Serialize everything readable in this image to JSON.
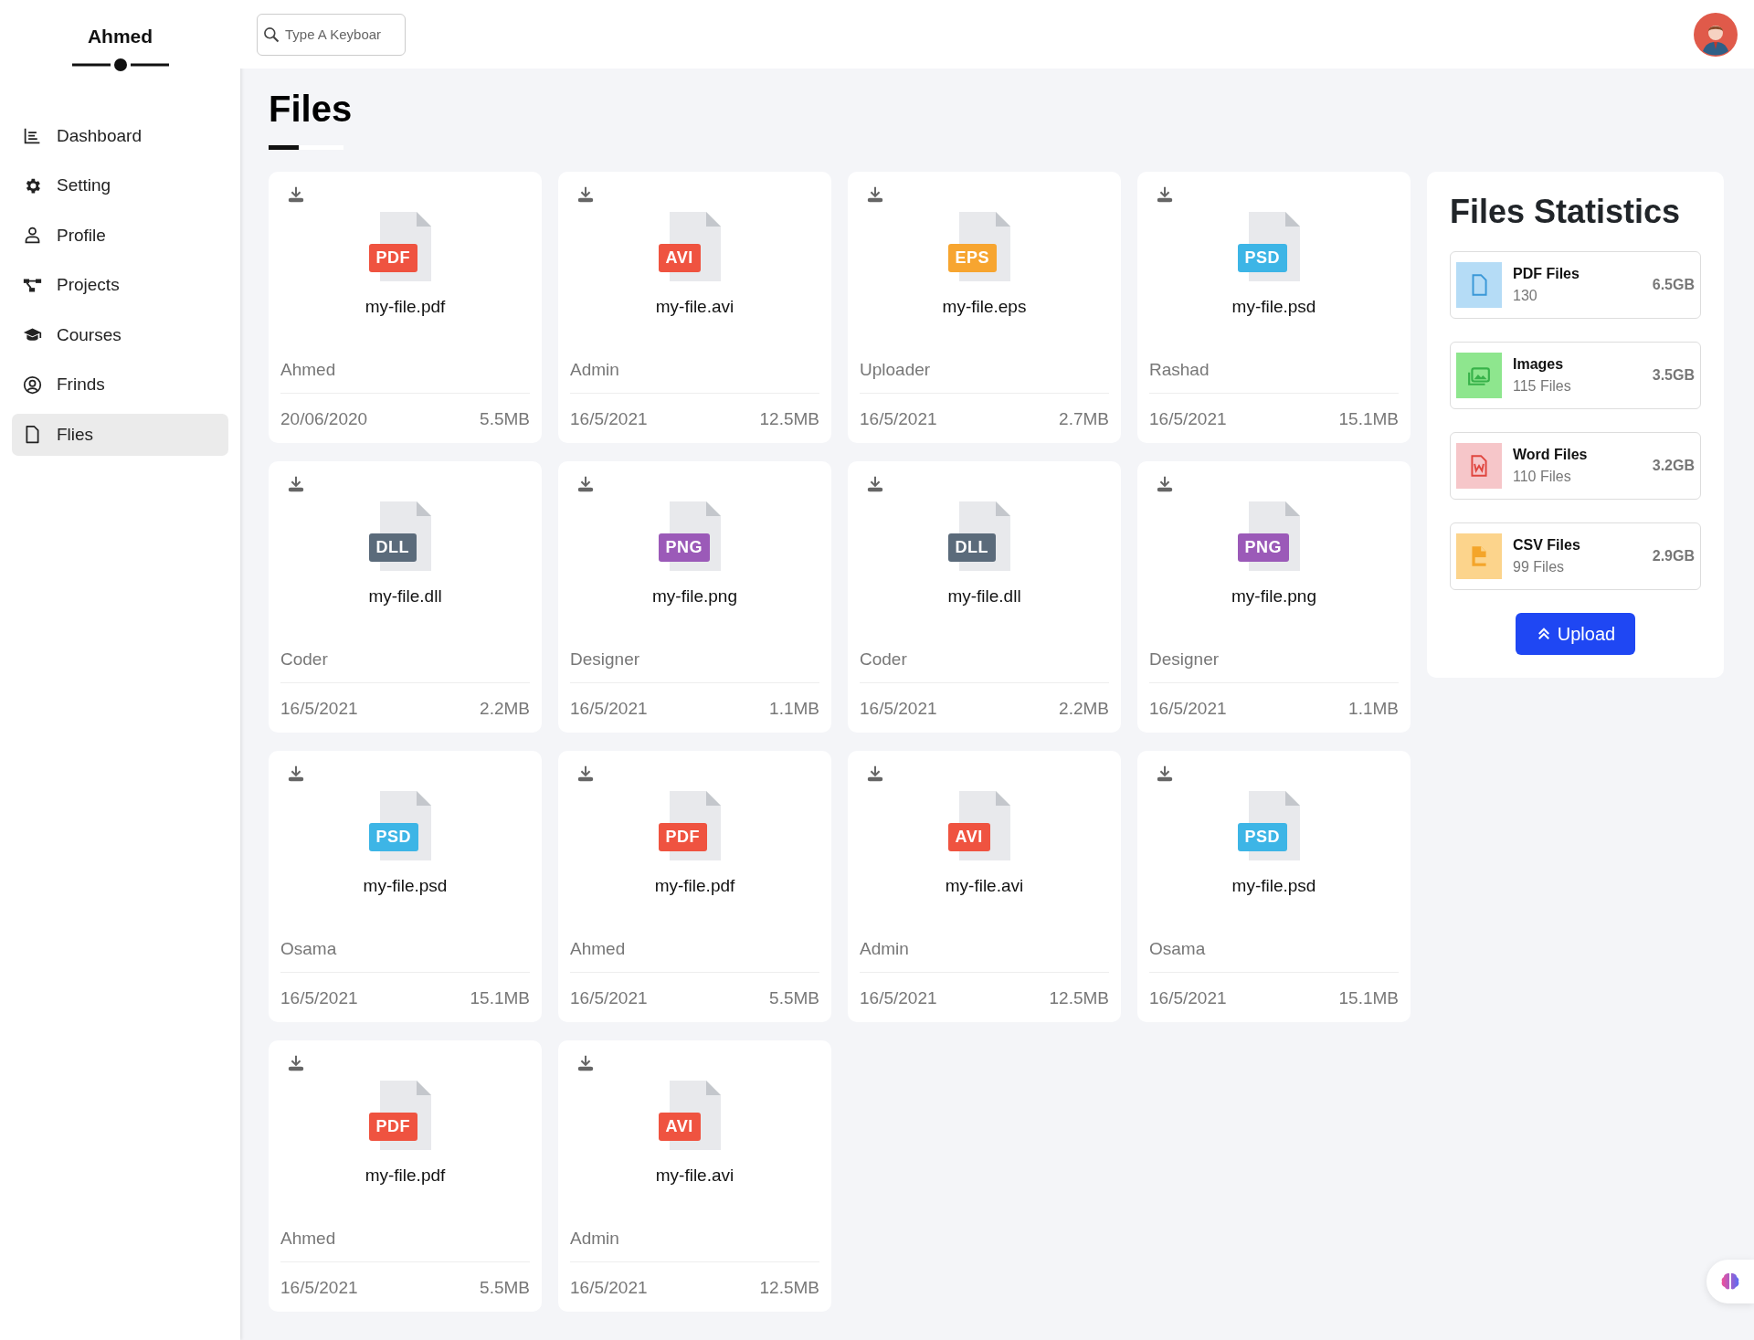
{
  "sidebar": {
    "title": "Ahmed",
    "items": [
      {
        "label": "Dashboard",
        "selected": false
      },
      {
        "label": "Setting",
        "selected": false
      },
      {
        "label": "Profile",
        "selected": false
      },
      {
        "label": "Projects",
        "selected": false
      },
      {
        "label": "Courses",
        "selected": false
      },
      {
        "label": "Frinds",
        "selected": false
      },
      {
        "label": "Flies",
        "selected": true
      }
    ]
  },
  "header": {
    "search": {
      "placeholder": "Type A Keyboar"
    }
  },
  "page_title": "Files",
  "files": [
    {
      "tag": "PDF",
      "color": "#ef5340",
      "name": "my-file.pdf",
      "owner": "Ahmed",
      "date": "20/06/2020",
      "size": "5.5MB"
    },
    {
      "tag": "AVI",
      "color": "#ef5340",
      "name": "my-file.avi",
      "owner": "Admin",
      "date": "16/5/2021",
      "size": "12.5MB"
    },
    {
      "tag": "EPS",
      "color": "#f7a530",
      "name": "my-file.eps",
      "owner": "Uploader",
      "date": "16/5/2021",
      "size": "2.7MB"
    },
    {
      "tag": "PSD",
      "color": "#3db5e6",
      "name": "my-file.psd",
      "owner": "Rashad",
      "date": "16/5/2021",
      "size": "15.1MB"
    },
    {
      "tag": "DLL",
      "color": "#5b6b7b",
      "name": "my-file.dll",
      "owner": "Coder",
      "date": "16/5/2021",
      "size": "2.2MB"
    },
    {
      "tag": "PNG",
      "color": "#9b5ab8",
      "name": "my-file.png",
      "owner": "Designer",
      "date": "16/5/2021",
      "size": "1.1MB"
    },
    {
      "tag": "DLL",
      "color": "#5b6b7b",
      "name": "my-file.dll",
      "owner": "Coder",
      "date": "16/5/2021",
      "size": "2.2MB"
    },
    {
      "tag": "PNG",
      "color": "#9b5ab8",
      "name": "my-file.png",
      "owner": "Designer",
      "date": "16/5/2021",
      "size": "1.1MB"
    },
    {
      "tag": "PSD",
      "color": "#3db5e6",
      "name": "my-file.psd",
      "owner": "Osama",
      "date": "16/5/2021",
      "size": "15.1MB"
    },
    {
      "tag": "PDF",
      "color": "#ef5340",
      "name": "my-file.pdf",
      "owner": "Ahmed",
      "date": "16/5/2021",
      "size": "5.5MB"
    },
    {
      "tag": "AVI",
      "color": "#ef5340",
      "name": "my-file.avi",
      "owner": "Admin",
      "date": "16/5/2021",
      "size": "12.5MB"
    },
    {
      "tag": "PSD",
      "color": "#3db5e6",
      "name": "my-file.psd",
      "owner": "Osama",
      "date": "16/5/2021",
      "size": "15.1MB"
    },
    {
      "tag": "PDF",
      "color": "#ef5340",
      "name": "my-file.pdf",
      "owner": "Ahmed",
      "date": "16/5/2021",
      "size": "5.5MB"
    },
    {
      "tag": "AVI",
      "color": "#ef5340",
      "name": "my-file.avi",
      "owner": "Admin",
      "date": "16/5/2021",
      "size": "12.5MB"
    }
  ],
  "statistics": {
    "title": "Files Statistics",
    "items": [
      {
        "title": "PDF Files",
        "count": "130",
        "size": "6.5GB",
        "color": "#b5dcf6"
      },
      {
        "title": "Images",
        "count": "115 Files",
        "size": "3.5GB",
        "color": "#8ee68e"
      },
      {
        "title": "Word Files",
        "count": "110 Files",
        "size": "3.2GB",
        "color": "#f6c6c9"
      },
      {
        "title": "CSV Files",
        "count": "99 Files",
        "size": "2.9GB",
        "color": "#fcd48c"
      }
    ],
    "button": "Upload"
  }
}
